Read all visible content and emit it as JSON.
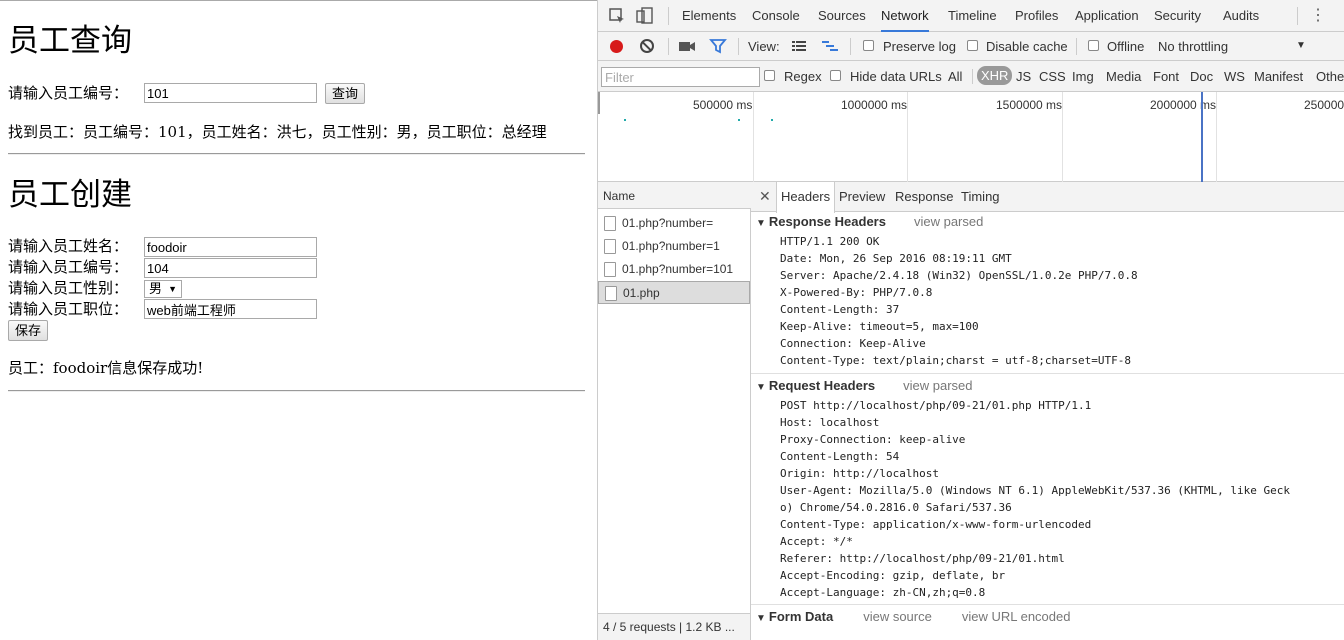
{
  "page": {
    "query_title": "员工查询",
    "query_label": "请输入员工编号：",
    "query_value": "101",
    "query_button": "查询",
    "query_result": "找到员工：员工编号：101，员工姓名：洪七，员工性别：男，员工职位：总经理",
    "create_title": "员工创建",
    "name_label": "请输入员工姓名：",
    "name_value": "foodoir",
    "number_label": "请输入员工编号：",
    "number_value": "104",
    "sex_label": "请输入员工性别：",
    "sex_value": "男",
    "job_label": "请输入员工职位：",
    "job_value": "web前端工程师",
    "save_button": "保存",
    "save_result": "员工：foodoir信息保存成功!"
  },
  "devtools": {
    "tabs": [
      "Elements",
      "Console",
      "Sources",
      "Network",
      "Timeline",
      "Profiles",
      "Application",
      "Security",
      "Audits"
    ],
    "active_tab": "Network",
    "toolbar": {
      "view_label": "View:",
      "preserve_log": "Preserve log",
      "disable_cache": "Disable cache",
      "offline": "Offline",
      "throttling": "No throttling"
    },
    "filter": {
      "placeholder": "Filter",
      "regex": "Regex",
      "hide_data_urls": "Hide data URLs",
      "types": [
        "All",
        "XHR",
        "JS",
        "CSS",
        "Img",
        "Media",
        "Font",
        "Doc",
        "WS",
        "Manifest",
        "Othe"
      ],
      "selected_type": "XHR"
    },
    "timeline_ticks": [
      "500000 ms",
      "1000000 ms",
      "1500000 ms",
      "2000000 ms",
      "250000"
    ],
    "name_header": "Name",
    "requests": [
      "01.php?number=",
      "01.php?number=1",
      "01.php?number=101",
      "01.php"
    ],
    "selected_request": "01.php",
    "status": "4 / 5 requests | 1.2 KB ...",
    "detail_tabs": [
      "Headers",
      "Preview",
      "Response",
      "Timing"
    ],
    "active_detail_tab": "Headers",
    "response_headers_title": "Response Headers",
    "response_headers_link": "view parsed",
    "response_headers": [
      "HTTP/1.1 200 OK",
      "Date: Mon, 26 Sep 2016 08:19:11 GMT",
      "Server: Apache/2.4.18 (Win32) OpenSSL/1.0.2e PHP/7.0.8",
      "X-Powered-By: PHP/7.0.8",
      "Content-Length: 37",
      "Keep-Alive: timeout=5, max=100",
      "Connection: Keep-Alive",
      "Content-Type: text/plain;charst = utf-8;charset=UTF-8"
    ],
    "request_headers_title": "Request Headers",
    "request_headers_link": "view parsed",
    "request_headers": [
      "POST http://localhost/php/09-21/01.php HTTP/1.1",
      "Host: localhost",
      "Proxy-Connection: keep-alive",
      "Content-Length: 54",
      "Origin: http://localhost",
      "User-Agent: Mozilla/5.0 (Windows NT 6.1) AppleWebKit/537.36 (KHTML, like Geck",
      "o) Chrome/54.0.2816.0 Safari/537.36",
      "Content-Type: application/x-www-form-urlencoded",
      "Accept: */*",
      "Referer: http://localhost/php/09-21/01.html",
      "Accept-Encoding: gzip, deflate, br",
      "Accept-Language: zh-CN,zh;q=0.8"
    ],
    "form_data_title": "Form Data",
    "form_data_link1": "view source",
    "form_data_link2": "view URL encoded"
  }
}
